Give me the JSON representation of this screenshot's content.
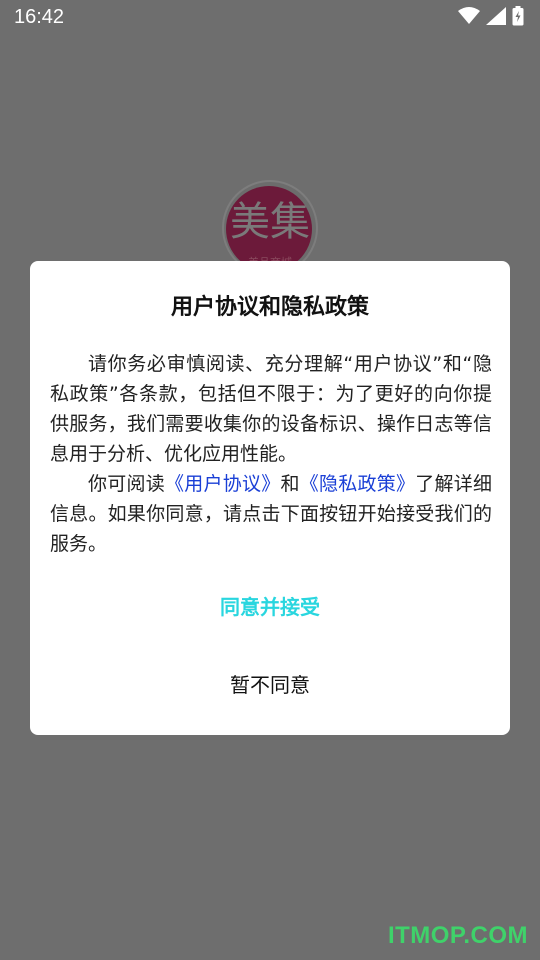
{
  "status_bar": {
    "time": "16:42",
    "icons": [
      "wifi-icon",
      "signal-icon",
      "battery-charging-icon"
    ]
  },
  "splash": {
    "logo_text": "美集",
    "logo_subtext": "美品商城"
  },
  "dialog": {
    "title": "用户协议和隐私政策",
    "paragraph1": "请你务必审慎阅读、充分理解“用户协议”和“隐私政策”各条款，包括但不限于：为了更好的向你提供服务，我们需要收集你的设备标识、操作日志等信息用于分析、优化应用性能。",
    "paragraph2_prefix": "你可阅读",
    "user_agreement_link": "《用户协议》",
    "paragraph2_and": "和",
    "privacy_policy_link": "《隐私政策》",
    "paragraph2_suffix": "了解详细信息。如果你同意，请点击下面按钮开始接受我们的服务。",
    "agree_label": "同意并接受",
    "disagree_label": "暂不同意"
  },
  "colors": {
    "agree": "#29d6df",
    "link": "#1a3fd6",
    "overlay": "#6e6e6e"
  },
  "watermark": "ITMOP.COM"
}
